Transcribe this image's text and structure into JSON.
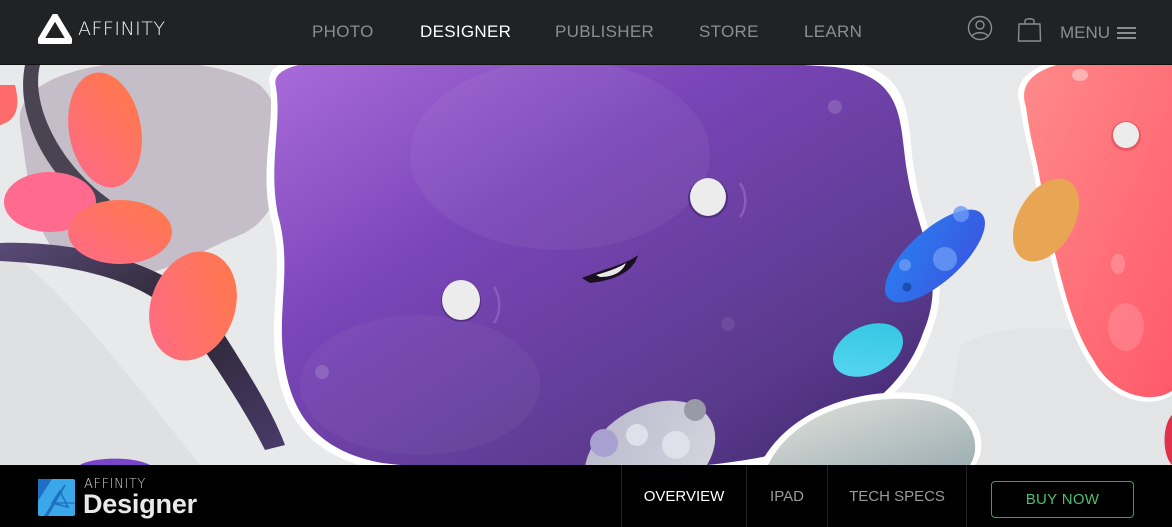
{
  "header": {
    "brand": "AFFINITY",
    "brand_icon": "affinity-triangle-logo",
    "nav": [
      {
        "label": "PHOTO",
        "active": false
      },
      {
        "label": "DESIGNER",
        "active": true
      },
      {
        "label": "PUBLISHER",
        "active": false
      },
      {
        "label": "STORE",
        "active": false
      },
      {
        "label": "LEARN",
        "active": false
      }
    ],
    "account_icon": "user-circle-icon",
    "cart_icon": "shopping-bag-icon",
    "menu_label": "MENU",
    "menu_icon": "hamburger-icon"
  },
  "hero": {
    "description": "Illustration of colorful glossy blob characters: a large purple blob with eyes and a smile, coral/pink pods on a dark branch, a blue and cyan pebble, and a coral-red blob on the right",
    "colors": {
      "background": "#e8e9ea",
      "purple": "#6b3fa6",
      "coral": "#ff6b6b",
      "orange": "#ff7a4f",
      "blue": "#2f6ee8",
      "cyan": "#3fd0ea",
      "tan": "#e8a654"
    }
  },
  "product_bar": {
    "brand_small": "AFFINITY",
    "brand_big": "Designer",
    "logo_icon": "affinity-designer-logo",
    "tabs": [
      {
        "label": "OVERVIEW",
        "active": true
      },
      {
        "label": "IPAD",
        "active": false
      },
      {
        "label": "TECH SPECS",
        "active": false
      }
    ],
    "buy_label": "BUY NOW",
    "accent": "#4cbf6e"
  }
}
